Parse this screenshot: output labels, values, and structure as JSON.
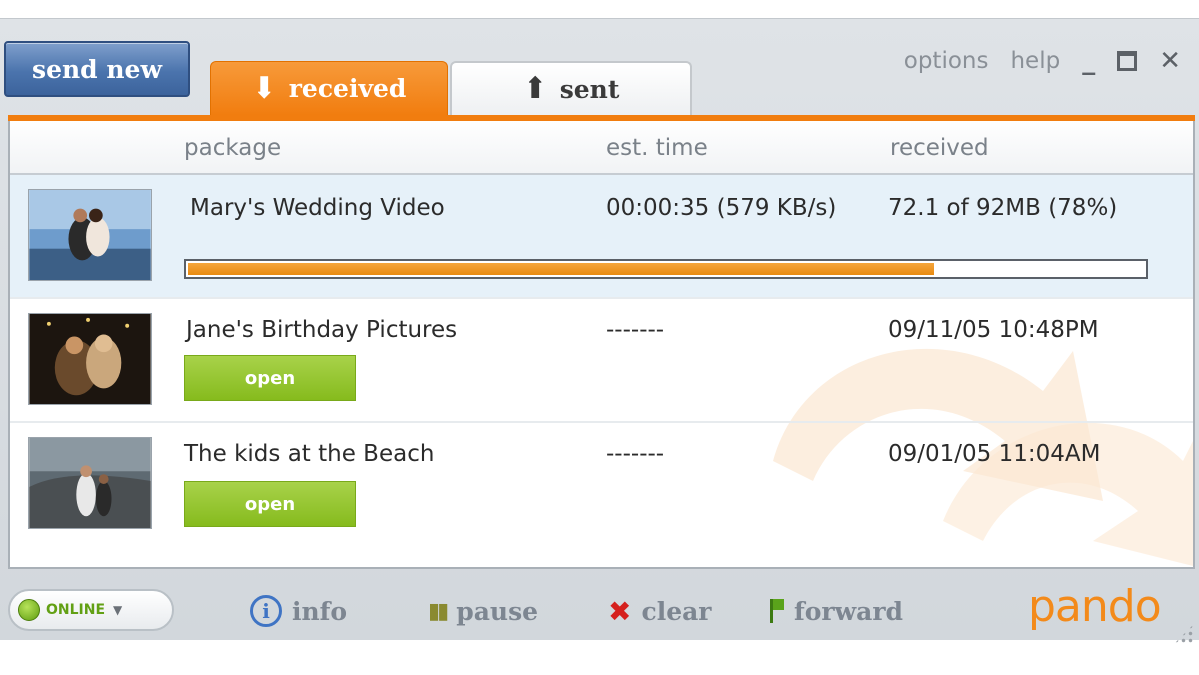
{
  "header": {
    "send_new": "send new",
    "tabs": [
      {
        "label": "received",
        "arrow": "⬇",
        "active": true
      },
      {
        "label": "sent",
        "arrow": "⬆",
        "active": false
      }
    ],
    "links": {
      "options": "options",
      "help": "help",
      "minimize": "_",
      "close": "✕"
    }
  },
  "columns": {
    "package": "package",
    "est_time": "est. time",
    "received": "received"
  },
  "rows": [
    {
      "name": "Mary's Wedding Video",
      "est_time": "00:00:35 (579 KB/s)",
      "received": "72.1 of 92MB (78%)",
      "progress": 0.78
    },
    {
      "name": "Jane's Birthday Pictures",
      "est_time": "-------",
      "received": "09/11/05 10:48PM",
      "button": "open"
    },
    {
      "name": "The kids at the Beach",
      "est_time": "-------",
      "received": "09/01/05 11:04AM",
      "button": "open"
    }
  ],
  "footer": {
    "status": "ONLINE",
    "info": "info",
    "pause": "pause",
    "clear": "clear",
    "forward": "forward",
    "logo": "pando"
  },
  "colors": {
    "accent_orange": "#f17d0f",
    "send_blue": "#4b74ad",
    "open_green": "#86bb1d",
    "online_green": "#62a014",
    "clear_red": "#d5201d"
  }
}
